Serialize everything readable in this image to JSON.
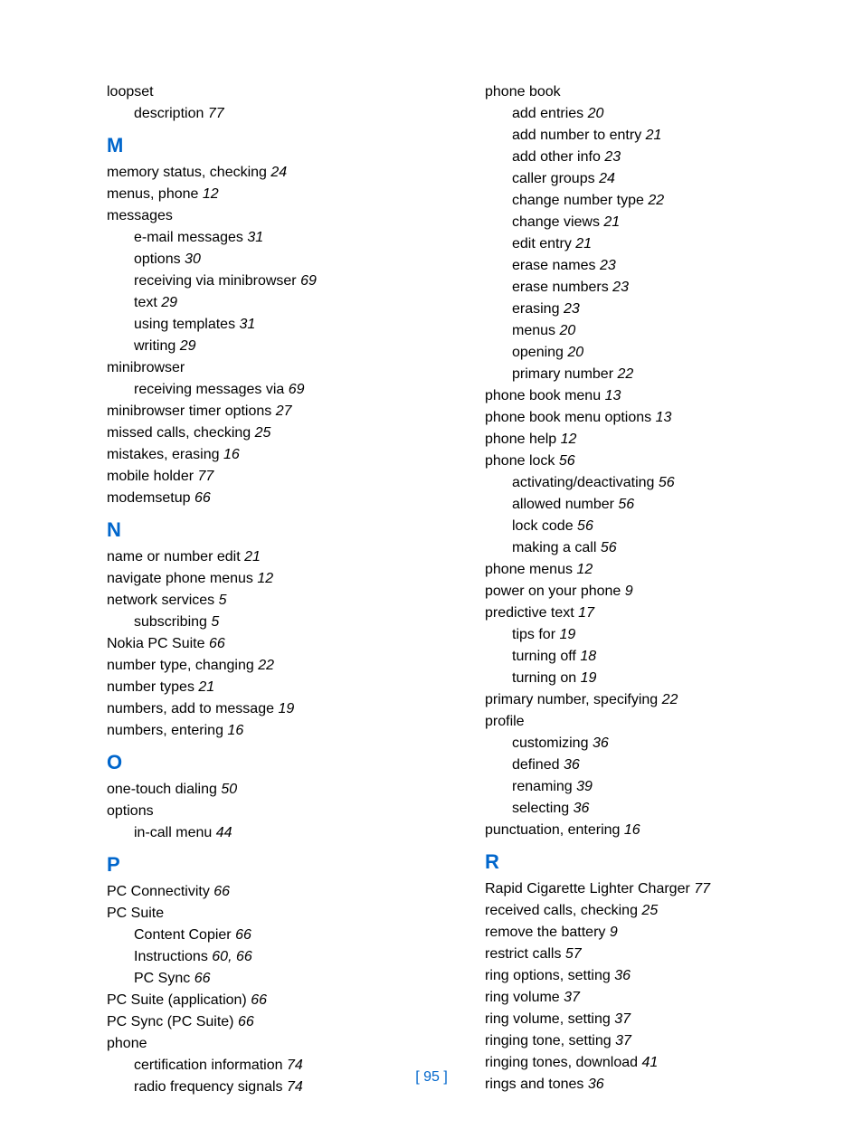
{
  "footer": "[ 95 ]",
  "columns": [
    [
      {
        "type": "entry",
        "text": "loopset"
      },
      {
        "type": "sub",
        "text": "description",
        "page": "77"
      },
      {
        "type": "letter",
        "text": "M"
      },
      {
        "type": "entry",
        "text": "memory status, checking",
        "page": "24"
      },
      {
        "type": "entry",
        "text": "menus, phone",
        "page": "12"
      },
      {
        "type": "entry",
        "text": "messages"
      },
      {
        "type": "sub",
        "text": "e-mail messages",
        "page": "31"
      },
      {
        "type": "sub",
        "text": "options",
        "page": "30"
      },
      {
        "type": "sub",
        "text": "receiving via minibrowser",
        "page": "69"
      },
      {
        "type": "sub",
        "text": "text",
        "page": "29"
      },
      {
        "type": "sub",
        "text": "using templates",
        "page": "31"
      },
      {
        "type": "sub",
        "text": "writing",
        "page": "29"
      },
      {
        "type": "entry",
        "text": "minibrowser"
      },
      {
        "type": "sub",
        "text": "receiving messages via",
        "page": "69"
      },
      {
        "type": "entry",
        "text": "minibrowser timer options",
        "page": "27"
      },
      {
        "type": "entry",
        "text": "missed calls, checking",
        "page": "25"
      },
      {
        "type": "entry",
        "text": "mistakes, erasing",
        "page": "16"
      },
      {
        "type": "entry",
        "text": "mobile holder",
        "page": "77"
      },
      {
        "type": "entry",
        "text": "modemsetup",
        "page": "66"
      },
      {
        "type": "letter",
        "text": "N"
      },
      {
        "type": "entry",
        "text": "name or number edit",
        "page": "21"
      },
      {
        "type": "entry",
        "text": "navigate phone menus",
        "page": "12"
      },
      {
        "type": "entry",
        "text": "network services",
        "page": "5"
      },
      {
        "type": "sub",
        "text": "subscribing",
        "page": "5"
      },
      {
        "type": "entry",
        "text": "Nokia PC Suite",
        "page": "66"
      },
      {
        "type": "entry",
        "text": "number type, changing",
        "page": "22"
      },
      {
        "type": "entry",
        "text": "number types",
        "page": "21"
      },
      {
        "type": "entry",
        "text": "numbers, add to message",
        "page": "19"
      },
      {
        "type": "entry",
        "text": "numbers, entering",
        "page": "16"
      },
      {
        "type": "letter",
        "text": "O"
      },
      {
        "type": "entry",
        "text": "one-touch dialing",
        "page": "50"
      },
      {
        "type": "entry",
        "text": "options"
      },
      {
        "type": "sub",
        "text": "in-call menu",
        "page": "44"
      },
      {
        "type": "letter",
        "text": "P"
      },
      {
        "type": "entry",
        "text": "PC Connectivity",
        "page": "66"
      },
      {
        "type": "entry",
        "text": "PC Suite"
      },
      {
        "type": "sub",
        "text": "Content Copier",
        "page": "66"
      },
      {
        "type": "sub",
        "text": "Instructions",
        "page": "60, 66"
      },
      {
        "type": "sub",
        "text": "PC Sync",
        "page": "66"
      },
      {
        "type": "entry",
        "text": "PC Suite (application)",
        "page": "66"
      },
      {
        "type": "entry",
        "text": "PC Sync (PC Suite)",
        "page": "66"
      },
      {
        "type": "entry",
        "text": "phone"
      },
      {
        "type": "sub",
        "text": "certification information",
        "page": "74"
      },
      {
        "type": "sub",
        "text": "radio frequency signals",
        "page": "74"
      }
    ],
    [
      {
        "type": "entry",
        "text": "phone book"
      },
      {
        "type": "sub",
        "text": "add entries",
        "page": "20"
      },
      {
        "type": "sub",
        "text": "add number to entry",
        "page": "21"
      },
      {
        "type": "sub",
        "text": "add other info",
        "page": "23"
      },
      {
        "type": "sub",
        "text": "caller groups",
        "page": "24"
      },
      {
        "type": "sub",
        "text": "change number type",
        "page": "22"
      },
      {
        "type": "sub",
        "text": "change views",
        "page": "21"
      },
      {
        "type": "sub",
        "text": "edit entry",
        "page": "21"
      },
      {
        "type": "sub",
        "text": "erase names",
        "page": "23"
      },
      {
        "type": "sub",
        "text": "erase numbers",
        "page": "23"
      },
      {
        "type": "sub",
        "text": "erasing",
        "page": "23"
      },
      {
        "type": "sub",
        "text": "menus",
        "page": "20"
      },
      {
        "type": "sub",
        "text": "opening",
        "page": "20"
      },
      {
        "type": "sub",
        "text": "primary number",
        "page": "22"
      },
      {
        "type": "entry",
        "text": "phone book menu",
        "page": "13"
      },
      {
        "type": "entry",
        "text": "phone book menu options",
        "page": "13"
      },
      {
        "type": "entry",
        "text": "phone help",
        "page": "12"
      },
      {
        "type": "entry",
        "text": "phone lock",
        "page": "56"
      },
      {
        "type": "sub",
        "text": "activating/deactivating",
        "page": "56"
      },
      {
        "type": "sub",
        "text": "allowed number",
        "page": "56"
      },
      {
        "type": "sub",
        "text": "lock code",
        "page": "56"
      },
      {
        "type": "sub",
        "text": "making a call",
        "page": "56"
      },
      {
        "type": "entry",
        "text": "phone menus",
        "page": "12"
      },
      {
        "type": "entry",
        "text": "power on your phone",
        "page": "9"
      },
      {
        "type": "entry",
        "text": "predictive text",
        "page": "17"
      },
      {
        "type": "sub",
        "text": "tips for",
        "page": "19"
      },
      {
        "type": "sub",
        "text": "turning off",
        "page": "18"
      },
      {
        "type": "sub",
        "text": "turning on",
        "page": "19"
      },
      {
        "type": "entry",
        "text": "primary number, specifying",
        "page": "22"
      },
      {
        "type": "entry",
        "text": "profile"
      },
      {
        "type": "sub",
        "text": "customizing",
        "page": "36"
      },
      {
        "type": "sub",
        "text": "defined",
        "page": "36"
      },
      {
        "type": "sub",
        "text": "renaming",
        "page": "39"
      },
      {
        "type": "sub",
        "text": "selecting",
        "page": "36"
      },
      {
        "type": "entry",
        "text": "punctuation, entering",
        "page": "16"
      },
      {
        "type": "letter",
        "text": "R"
      },
      {
        "type": "entry",
        "text": "Rapid Cigarette Lighter Charger",
        "page": "77"
      },
      {
        "type": "entry",
        "text": "received calls, checking",
        "page": "25"
      },
      {
        "type": "entry",
        "text": "remove the battery",
        "page": "9"
      },
      {
        "type": "entry",
        "text": "restrict calls",
        "page": "57"
      },
      {
        "type": "entry",
        "text": "ring options, setting",
        "page": "36"
      },
      {
        "type": "entry",
        "text": "ring volume",
        "page": "37"
      },
      {
        "type": "entry",
        "text": "ring volume, setting",
        "page": "37"
      },
      {
        "type": "entry",
        "text": "ringing tone, setting",
        "page": "37"
      },
      {
        "type": "entry",
        "text": "ringing tones, download",
        "page": "41"
      },
      {
        "type": "entry",
        "text": "rings and tones",
        "page": "36"
      }
    ]
  ]
}
